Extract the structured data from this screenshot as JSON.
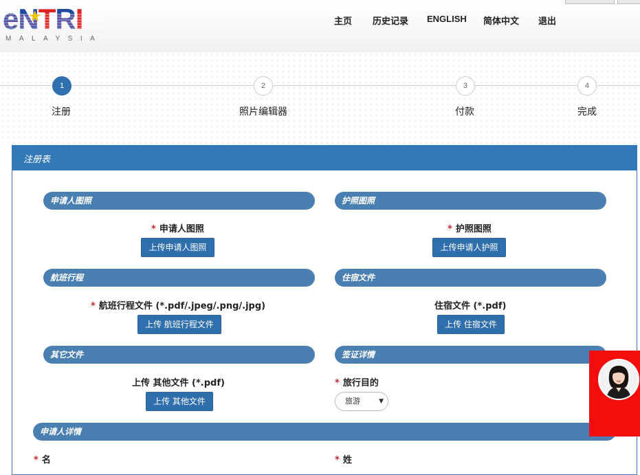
{
  "logo": {
    "word_e": "e",
    "word_n": "N",
    "word_t": "T",
    "word_r": "R",
    "word_i": "I",
    "tagline": "MALAYSIA"
  },
  "nav": {
    "home": "主页",
    "history": "历史记录",
    "english": "ENGLISH",
    "chinese": "简体中文",
    "logout": "退出"
  },
  "steps": [
    {
      "number": "1",
      "label": "注册",
      "active": true
    },
    {
      "number": "2",
      "label": "照片编辑器",
      "active": false
    },
    {
      "number": "3",
      "label": "付款",
      "active": false
    },
    {
      "number": "4",
      "label": "完成",
      "active": false
    }
  ],
  "form": {
    "title": "注册表",
    "applicant_photo": {
      "section": "申请人图照",
      "label": "申请人图照",
      "button": "上传申请人图照"
    },
    "passport_photo": {
      "section": "护照图照",
      "label": "护照图照",
      "button": "上传申请人护照"
    },
    "flight": {
      "section": "航班行程",
      "label": "航班行程文件 (*.pdf/.jpeg/.png/.jpg)",
      "button": "上传 航班行程文件"
    },
    "accommodation": {
      "section": "住宿文件",
      "label": "住宿文件 (*.pdf)",
      "button": "上传 住宿文件"
    },
    "other": {
      "section": "其它文件",
      "label": "上传 其他文件 (*.pdf)",
      "button": "上传 其他文件"
    },
    "visa": {
      "section": "签证详情",
      "purpose_label": "旅行目的",
      "purpose_value": "旅游"
    },
    "applicant_details": {
      "section": "申请人详情",
      "given_name_label": "名",
      "surname_label": "姓"
    },
    "required_mark": "*"
  },
  "colors": {
    "primary": "#3479b7",
    "section": "#4a7fb1",
    "required": "#d0262e",
    "chat": "#f40d0d"
  }
}
